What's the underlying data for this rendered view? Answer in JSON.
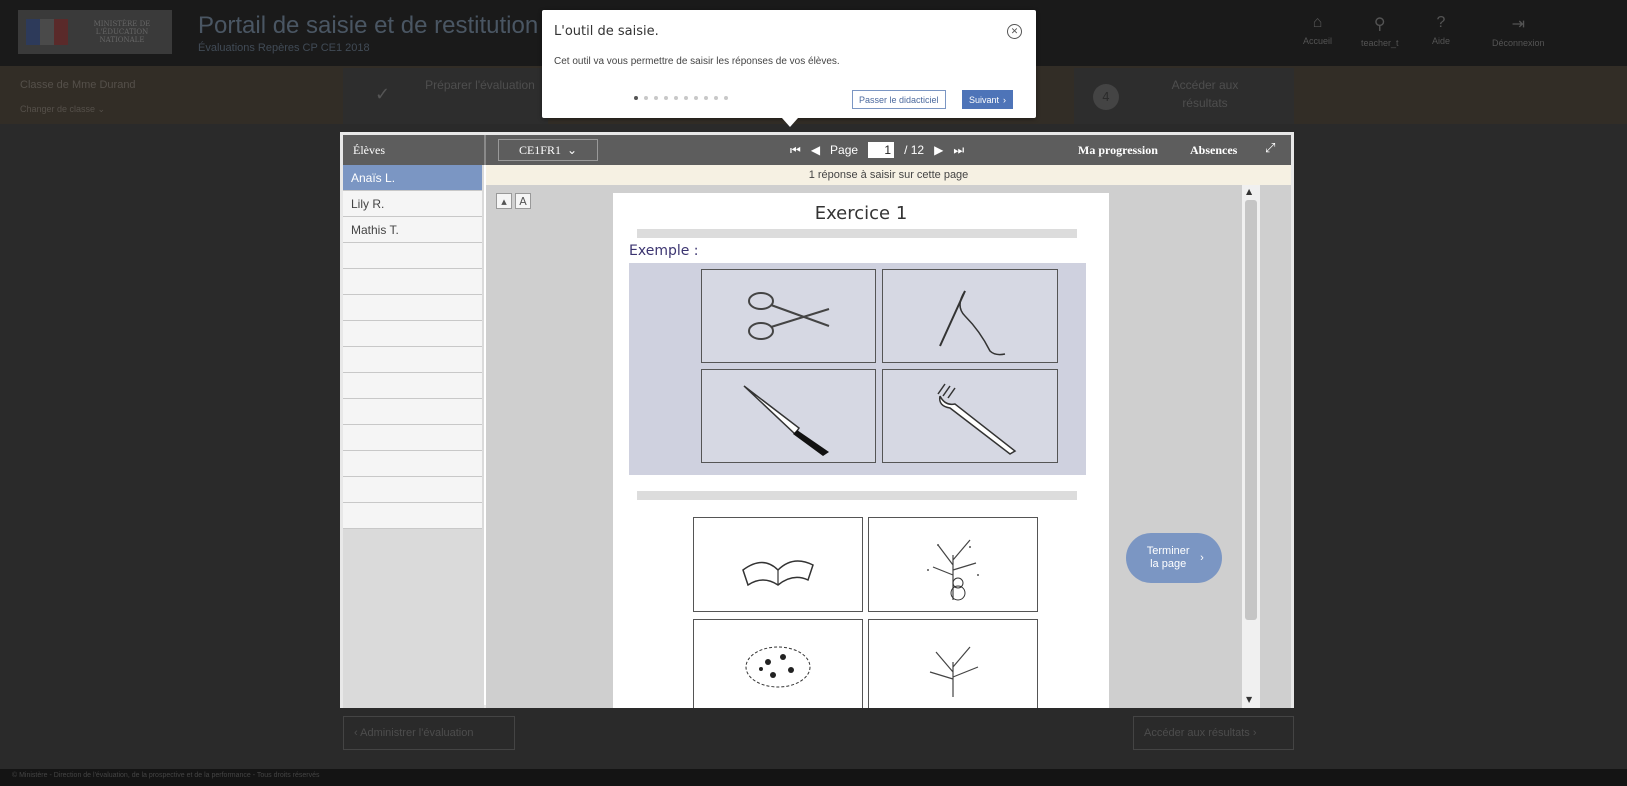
{
  "app": {
    "title": "Portail de saisie et de restitution",
    "subtitle": "Évaluations Repères CP CE1 2018",
    "ministry": "MINISTÈRE DE L'ÉDUCATION NATIONALE",
    "nav": [
      {
        "icon": "home-icon",
        "label": "Accueil"
      },
      {
        "icon": "user-icon",
        "label": "teacher_t"
      },
      {
        "icon": "help-icon",
        "label": "Aide"
      },
      {
        "icon": "logout-icon",
        "label": "Déconnexion"
      }
    ]
  },
  "stepbar": {
    "class_name": "Classe de Mme Durand",
    "change_class": "Changer de classe ⌄",
    "steps": [
      {
        "label": "Préparer l'évaluation",
        "state": "done"
      },
      {
        "label": "Accéder aux résultats",
        "number": "4"
      }
    ]
  },
  "bottom": {
    "back": "‹  Administrer l'évaluation",
    "next": "Accéder aux résultats  ›"
  },
  "footer": "© Ministère - Direction de l'évaluation, de la prospective et de la performance - Tous droits réservés",
  "modal": {
    "students_header": "Élèves",
    "students": [
      "Anaïs L.",
      "Lily R.",
      "Mathis T."
    ],
    "active_student": "Anaïs L.",
    "booklet": "CE1FR1",
    "page_label": "Page",
    "page_current": "1",
    "page_total": "/ 12",
    "progress_link": "Ma progression",
    "absences_link": "Absences",
    "notice": "1 réponse à saisir sur cette page",
    "exercise_title": "Exercice 1",
    "example_label": "Exemple :",
    "finish_button": "Terminer la page"
  },
  "tooltip": {
    "title": "L'outil de saisie.",
    "text": "Cet outil va vous permettre de saisir les réponses de vos élèves.",
    "dots_total": 10,
    "dots_active": 1,
    "skip": "Passer le didacticiel",
    "next": "Suivant"
  },
  "colors": {
    "accent": "#7b96c3",
    "primary_button": "#4e74b8",
    "toolbar": "#5d5d5d",
    "notice_bg": "#f6f1e3"
  }
}
